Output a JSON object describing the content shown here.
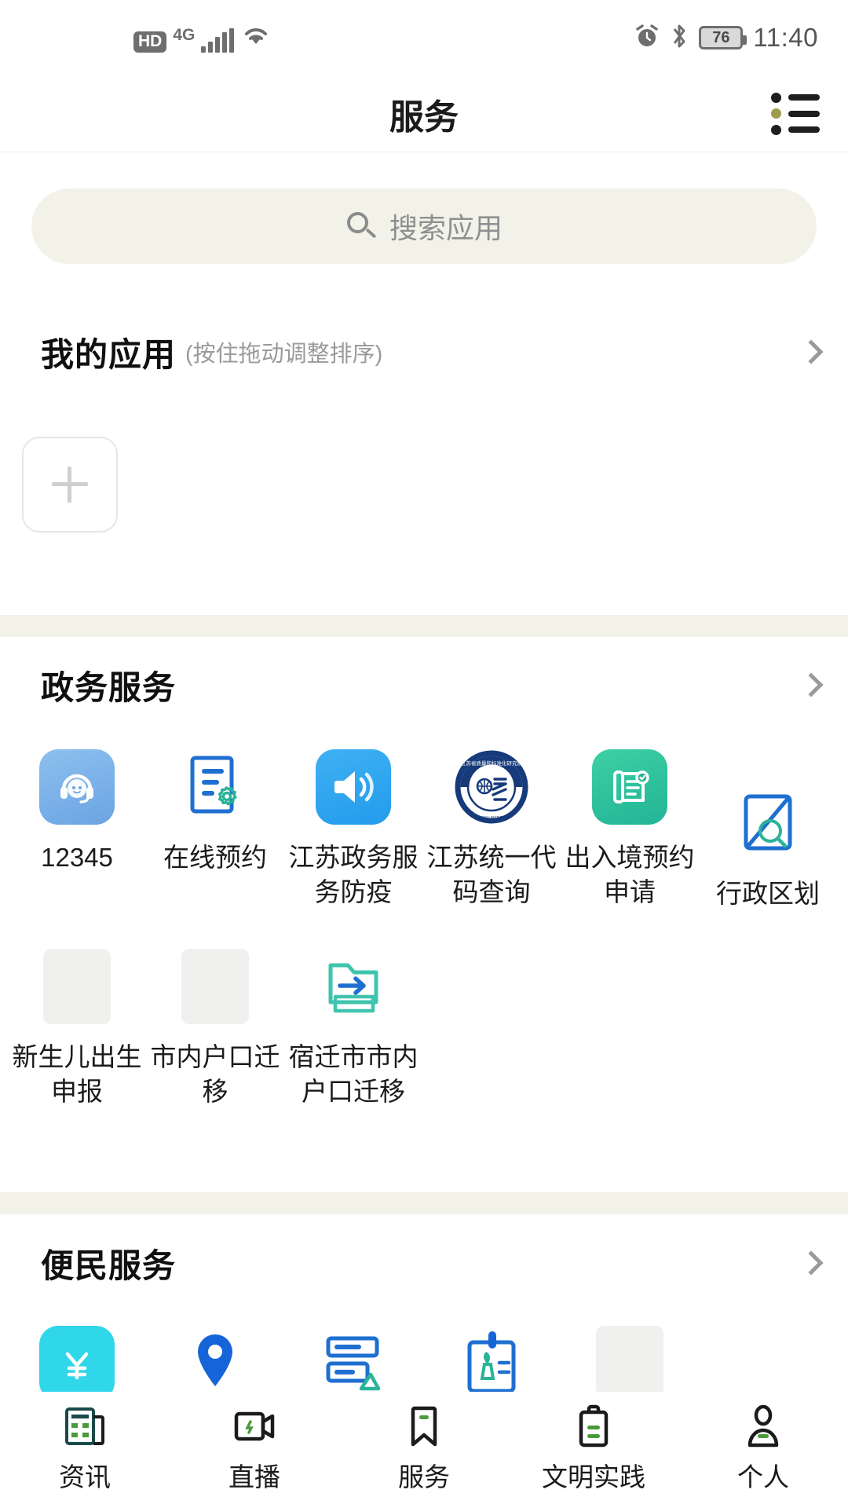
{
  "statusbar": {
    "hd_label": "HD",
    "network_label": "4G",
    "signal_icon": "signal-bars-icon",
    "wifi_icon": "wifi-icon",
    "alarm_icon": "alarm-clock-icon",
    "bluetooth_icon": "bluetooth-icon",
    "battery_level": "76",
    "time": "11:40"
  },
  "header": {
    "title": "服务",
    "menu_icon": "list-menu-icon",
    "menu_accent_color": "#9c9c4b"
  },
  "search": {
    "placeholder": "搜索应用",
    "icon": "search-icon",
    "background": "#f2f2e9"
  },
  "my_apps": {
    "title": "我的应用",
    "subtitle": "(按住拖动调整排序)",
    "chevron_icon": "chevron-right-icon",
    "add_button_icon": "plus-icon"
  },
  "sections": [
    {
      "title": "政务服务",
      "chevron_icon": "chevron-right-icon",
      "items": [
        {
          "label": "12345",
          "icon": "headset-operator-icon",
          "style": "blue-square"
        },
        {
          "label": "在线预约",
          "icon": "document-gear-icon",
          "style": "outline-doc-gear"
        },
        {
          "label": "江苏政务服务防疫",
          "icon": "speaker-announce-icon",
          "style": "blue-square-speaker"
        },
        {
          "label": "江苏统一代码查询",
          "icon": "official-seal-badge-icon",
          "style": "circular-seal"
        },
        {
          "label": "出入境预约申请",
          "icon": "scroll-document-icon",
          "style": "green-square"
        },
        {
          "label": "行政区划",
          "icon": "map-region-search-icon",
          "style": "outline-map"
        },
        {
          "label": "新生儿出生申报",
          "icon": "placeholder-icon",
          "style": "placeholder"
        },
        {
          "label": "市内户口迁移",
          "icon": "placeholder-icon",
          "style": "placeholder"
        },
        {
          "label": "宿迁市市内户口迁移",
          "icon": "folder-arrow-icon",
          "style": "outline-folder"
        }
      ]
    },
    {
      "title": "便民服务",
      "chevron_icon": "chevron-right-icon",
      "items": [
        {
          "label": "",
          "icon": "yuan-money-icon",
          "style": "cyan-square"
        },
        {
          "label": "",
          "icon": "location-pin-icon",
          "style": "blue-pin"
        },
        {
          "label": "",
          "icon": "document-lines-icon",
          "style": "blue-doc"
        },
        {
          "label": "",
          "icon": "clipboard-plant-icon",
          "style": "blue-clipboard"
        },
        {
          "label": "",
          "icon": "placeholder-icon",
          "style": "placeholder"
        }
      ]
    }
  ],
  "tabbar": [
    {
      "label": "资讯",
      "icon": "newspaper-icon",
      "active": false
    },
    {
      "label": "直播",
      "icon": "video-camera-icon",
      "active": false
    },
    {
      "label": "服务",
      "icon": "bookmark-icon",
      "active": true
    },
    {
      "label": "文明实践",
      "icon": "clipboard-icon",
      "active": false
    },
    {
      "label": "个人",
      "icon": "person-icon",
      "active": false
    }
  ]
}
